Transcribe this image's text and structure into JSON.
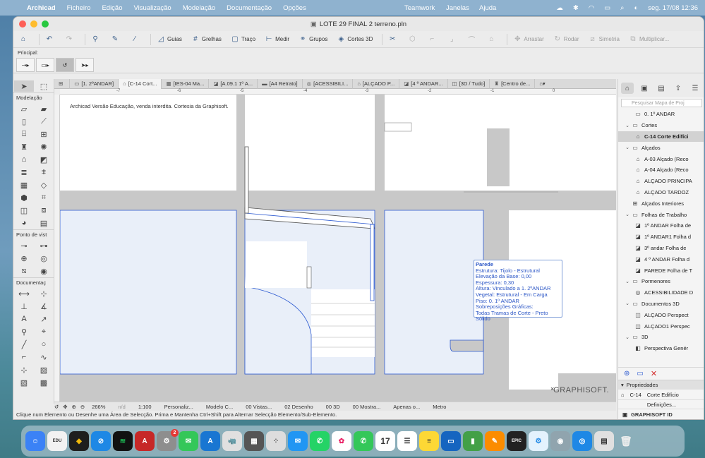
{
  "menubar": {
    "app": "Archicad",
    "items": [
      "Ficheiro",
      "Edição",
      "Visualização",
      "Modelação",
      "Documentação",
      "Opções"
    ],
    "right_items": [
      "Teamwork",
      "Janelas",
      "Ajuda"
    ],
    "datetime": "seg. 17/08  12:36"
  },
  "window": {
    "title": "LOTE 29 FINAL 2 terreno.pln"
  },
  "toolbar": {
    "guias": "Guias",
    "grelhas": "Grelhas",
    "traco": "Traço",
    "medir": "Medir",
    "grupos": "Grupos",
    "cortes3d": "Cortes 3D",
    "arrastar": "Arrastar",
    "rodar": "Rodar",
    "simetria": "Simetria",
    "multiplicar": "Multiplicar..."
  },
  "infobox": {
    "label": "Principal:"
  },
  "toolbox": {
    "modelacao": "Modelação",
    "ponto_de_vista": "Ponto de vist",
    "documentacao": "Documentaç"
  },
  "tabs": [
    "[1. 2ºANDAR]",
    "[C-14 Cort...",
    "[IES-04 Ma...",
    "[A.09.1 1º A...",
    "[A4 Retrato]",
    "[ACESSIBILI...",
    "[ALÇADO P...",
    "[4 º ANDAR...",
    "[3D / Tudo]",
    "[Centro de..."
  ],
  "ruler": [
    "-7",
    "-6",
    "-5",
    "-4",
    "-3",
    "-2",
    "-1",
    "0"
  ],
  "canvas": {
    "edu_note": "Archicad Versão Educação, venda interdita. Cortesia da Graphisoft.",
    "watermark": "GRAPHISOFT."
  },
  "tooltip": {
    "title": "Parede",
    "lines": [
      "Estrutura: Tijolo - Estrutural",
      "Elevação da Base: 0,00",
      "Espessura: 0,30",
      "Altura: Vinculado a 1. 2ºANDAR",
      "Vegetal: Estrutural - Em Carga",
      "Piso: 0. 1º ANDAR",
      "Sobreposições Gráficas:",
      "Todas Tramas de Corte - Preto Sólido"
    ]
  },
  "statusbar": {
    "zoom": "266%",
    "angle": "n/d",
    "scale": "1:100",
    "personaliz": "Personaliz...",
    "modelo": "Modelo C...",
    "vistas": "00 Vistas...",
    "desenho": "02 Desenho",
    "tres_d": "00 3D",
    "mostra": "00 Mostra...",
    "apenas": "Apenas o...",
    "units": "Metro"
  },
  "hint": "Clique num Elemento ou Desenhe uma Área de Selecção. Prima e Mantenha Ctrl+Shift para Alternar Selecção Elemento/Sub-Elemento.",
  "navigator": {
    "search_placeholder": "Pesquisar Mapa de Proj",
    "tree": [
      {
        "label": "0. 1º ANDAR",
        "indent": 2,
        "icon": "floor",
        "chev": ""
      },
      {
        "label": "Cortes",
        "indent": 1,
        "icon": "folder",
        "chev": "v"
      },
      {
        "label": "C-14 Corte Edifíci",
        "indent": 2,
        "icon": "section",
        "chev": "",
        "selected": true
      },
      {
        "label": "Alçados",
        "indent": 1,
        "icon": "folder",
        "chev": "v"
      },
      {
        "label": "A-03 Alçado (Reco",
        "indent": 2,
        "icon": "elevation",
        "chev": ""
      },
      {
        "label": "A-04 Alçado (Reco",
        "indent": 2,
        "icon": "elevation",
        "chev": ""
      },
      {
        "label": "ALÇADO PRINCIPA",
        "indent": 2,
        "icon": "elevation",
        "chev": ""
      },
      {
        "label": "ALÇADO TARDOZ",
        "indent": 2,
        "icon": "elevation",
        "chev": ""
      },
      {
        "label": "Alçados Interiores",
        "indent": 1,
        "icon": "interior",
        "chev": ""
      },
      {
        "label": "Folhas de Trabalho",
        "indent": 1,
        "icon": "folder",
        "chev": "v"
      },
      {
        "label": "1º ANDAR Folha de",
        "indent": 2,
        "icon": "worksheet",
        "chev": ""
      },
      {
        "label": "1º ANDAR1 Folha d",
        "indent": 2,
        "icon": "worksheet",
        "chev": ""
      },
      {
        "label": "3º andar Folha de",
        "indent": 2,
        "icon": "worksheet",
        "chev": ""
      },
      {
        "label": "4 º ANDAR Folha d",
        "indent": 2,
        "icon": "worksheet",
        "chev": ""
      },
      {
        "label": "PAREDE Folha de T",
        "indent": 2,
        "icon": "worksheet",
        "chev": ""
      },
      {
        "label": "Pormenores",
        "indent": 1,
        "icon": "folder",
        "chev": "v"
      },
      {
        "label": "ACESSIBILIDADE D",
        "indent": 2,
        "icon": "detail",
        "chev": ""
      },
      {
        "label": "Documentos 3D",
        "indent": 1,
        "icon": "folder",
        "chev": "v"
      },
      {
        "label": "ALÇADO Perspect",
        "indent": 2,
        "icon": "doc3d",
        "chev": ""
      },
      {
        "label": "ALÇADO1 Perspec",
        "indent": 2,
        "icon": "doc3d",
        "chev": ""
      },
      {
        "label": "3D",
        "indent": 1,
        "icon": "folder",
        "chev": "v"
      },
      {
        "label": "Perspectiva Genér",
        "indent": 2,
        "icon": "perspective",
        "chev": ""
      }
    ],
    "properties_label": "Propriedades",
    "prop_id": "C-14",
    "prop_name": "Corte Edifício",
    "definitions": "Definições...",
    "graphisoft_id": "GRAPHISOFT ID"
  },
  "colors": {
    "wall_fill": "#c8c8c8",
    "zone_fill": "#e9eff9",
    "selection": "#2e5bd1",
    "menubar": "#8fb2cf"
  }
}
